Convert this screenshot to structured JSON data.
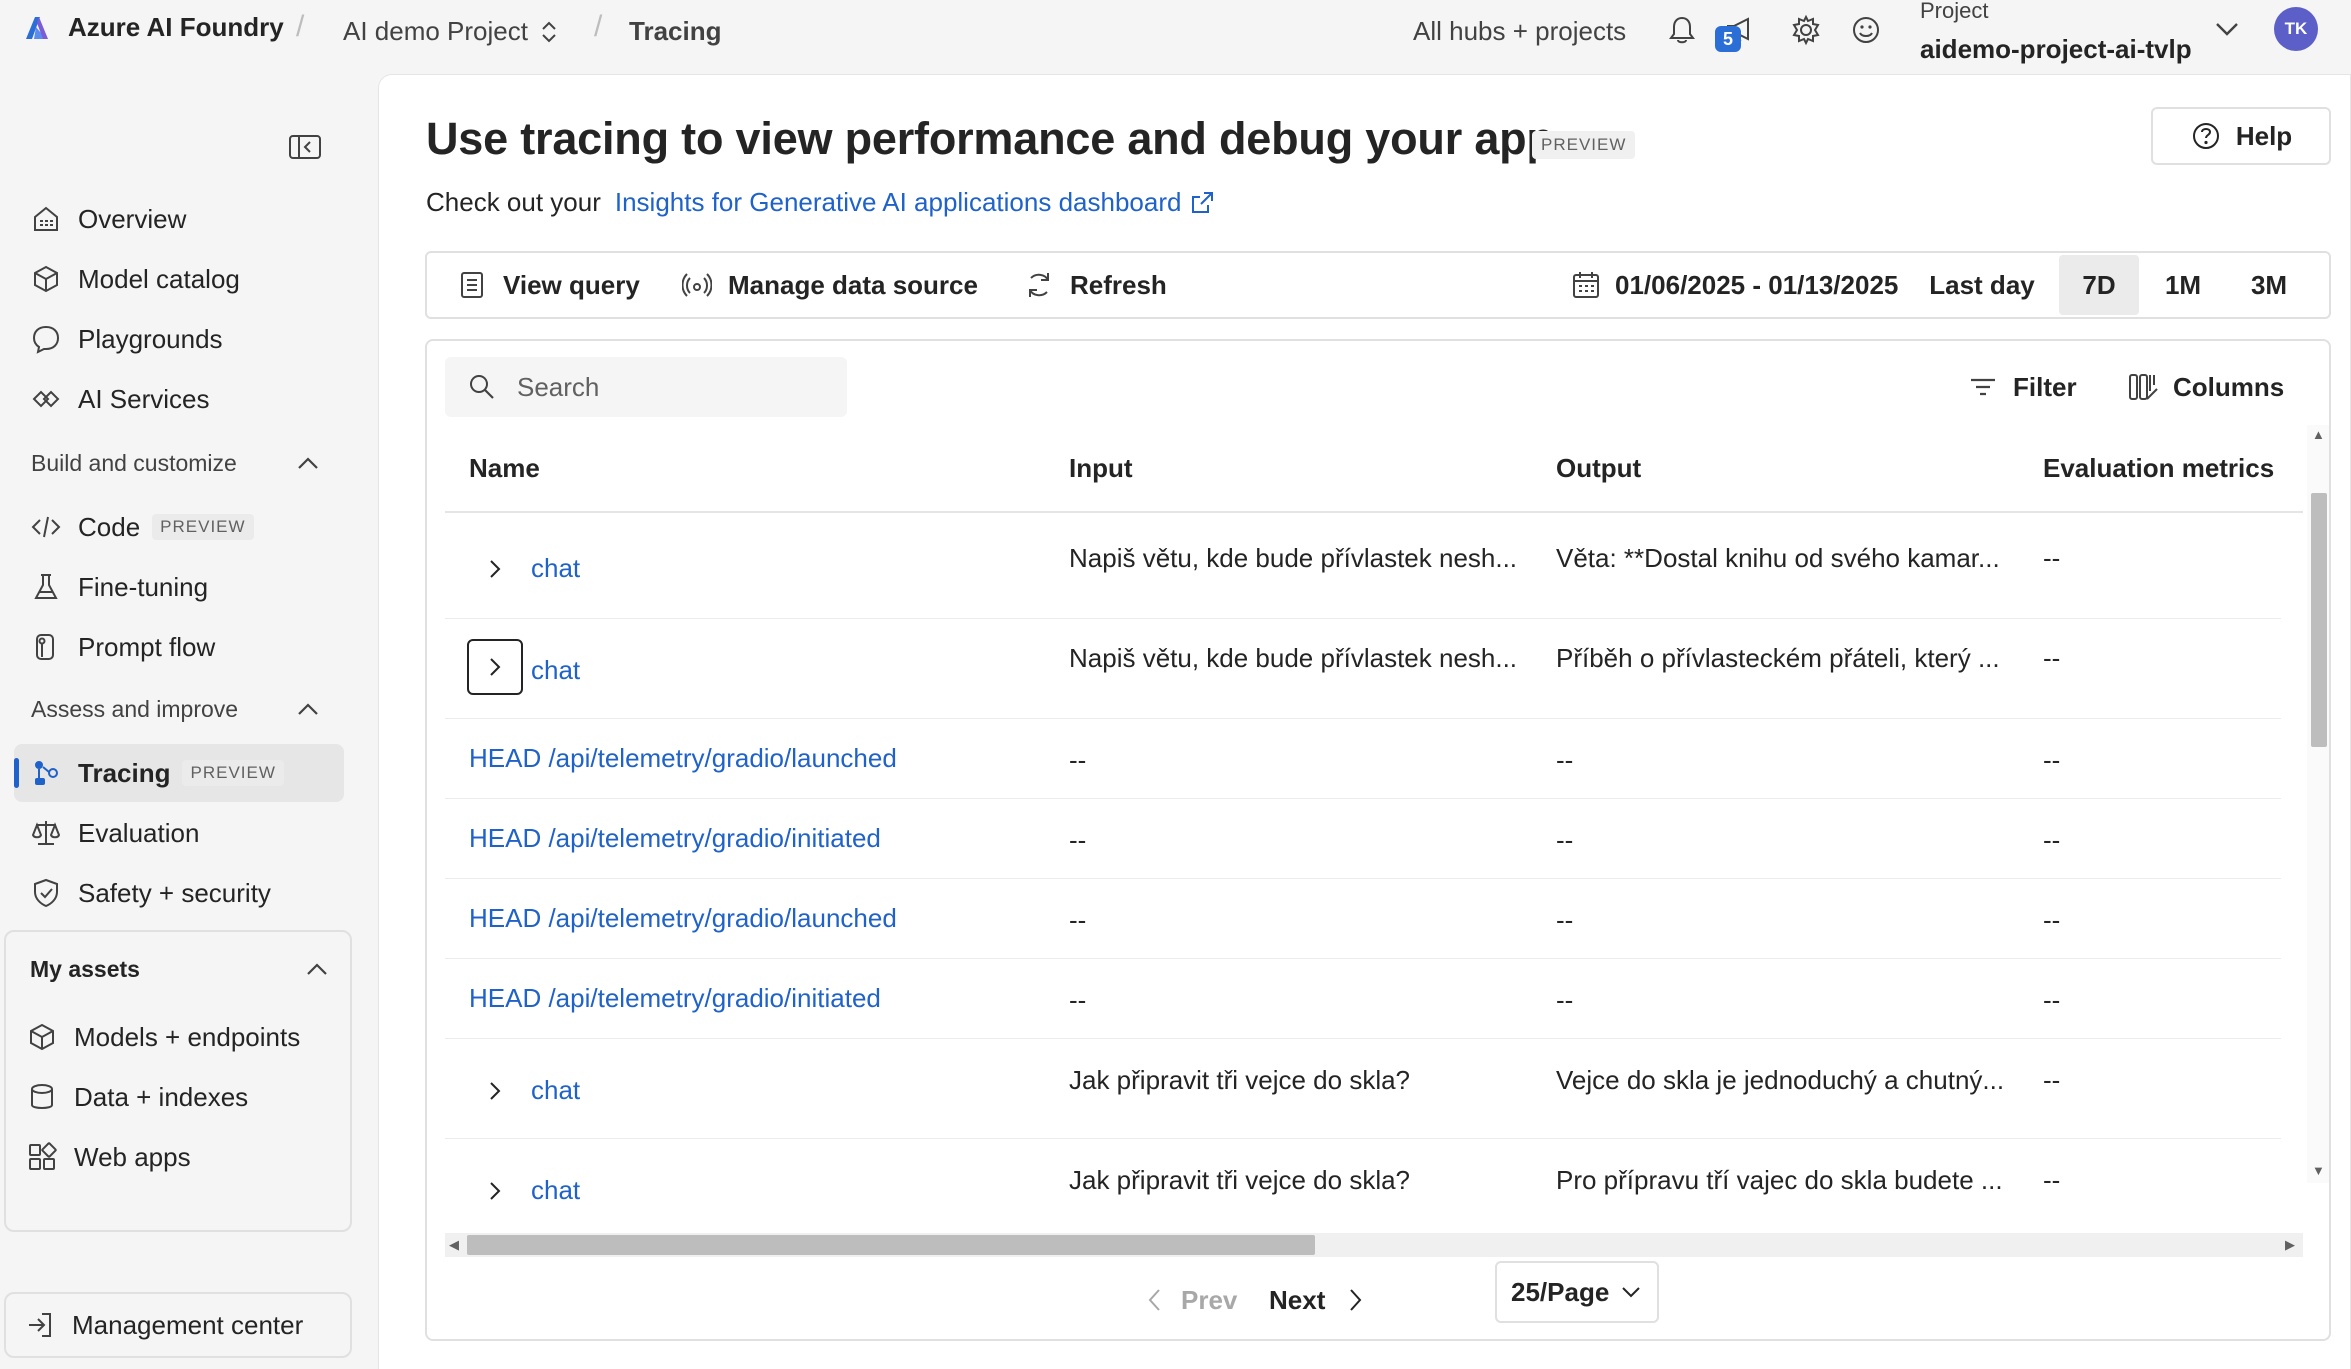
{
  "topbar": {
    "brand": "Azure AI Foundry",
    "project_crumb": "AI demo Project",
    "current_crumb": "Tracing",
    "hubs_link": "All hubs + projects",
    "notification_count": "5",
    "project_label": "Project",
    "project_name": "aidemo-project-ai-tvlp",
    "avatar_initials": "TK"
  },
  "sidebar": {
    "top_items": [
      {
        "label": "Overview",
        "icon": "overview-icon"
      },
      {
        "label": "Model catalog",
        "icon": "cube-icon"
      },
      {
        "label": "Playgrounds",
        "icon": "chat-icon"
      },
      {
        "label": "AI Services",
        "icon": "services-icon"
      }
    ],
    "build_section": "Build and customize",
    "build_items": [
      {
        "label": "Code",
        "tag": "PREVIEW",
        "icon": "code-icon"
      },
      {
        "label": "Fine-tuning",
        "icon": "flask-icon"
      },
      {
        "label": "Prompt flow",
        "icon": "flow-icon"
      }
    ],
    "assess_section": "Assess and improve",
    "assess_items": [
      {
        "label": "Tracing",
        "tag": "PREVIEW",
        "icon": "tracing-icon",
        "active": true
      },
      {
        "label": "Evaluation",
        "icon": "scale-icon"
      },
      {
        "label": "Safety + security",
        "icon": "shield-icon"
      }
    ],
    "assets_section": "My assets",
    "asset_items": [
      {
        "label": "Models + endpoints",
        "icon": "cube-icon"
      },
      {
        "label": "Data + indexes",
        "icon": "database-icon"
      },
      {
        "label": "Web apps",
        "icon": "apps-icon"
      }
    ],
    "management": "Management center"
  },
  "main": {
    "title": "Use tracing to view performance and debug your app",
    "title_tag": "PREVIEW",
    "help": "Help",
    "subline_prefix": "Check out your",
    "subline_link": "Insights for Generative AI applications dashboard"
  },
  "toolbar": {
    "view_query": "View query",
    "manage_source": "Manage data source",
    "refresh": "Refresh",
    "date_range": "01/06/2025 - 01/13/2025",
    "ranges": [
      "Last day",
      "7D",
      "1M",
      "3M"
    ],
    "selected_range": "7D"
  },
  "table": {
    "search_placeholder": "Search",
    "filter": "Filter",
    "columns": "Columns",
    "headers": [
      "Name",
      "Input",
      "Output",
      "Evaluation metrics"
    ],
    "rows": [
      {
        "name": "chat",
        "expandable": true,
        "input": "Napiš větu, kde bude přívlastek nesh...",
        "output": "Věta: **Dostal knihu od svého kamar...",
        "metrics": "--"
      },
      {
        "name": "chat",
        "expandable": true,
        "focused": true,
        "input": "Napiš větu, kde bude přívlastek nesh...",
        "output": "Příběh o přívlasteckém přáteli, který ...",
        "metrics": "--"
      },
      {
        "name": "HEAD /api/telemetry/gradio/launched",
        "expandable": false,
        "input": "--",
        "output": "--",
        "metrics": "--"
      },
      {
        "name": "HEAD /api/telemetry/gradio/initiated",
        "expandable": false,
        "input": "--",
        "output": "--",
        "metrics": "--"
      },
      {
        "name": "HEAD /api/telemetry/gradio/launched",
        "expandable": false,
        "input": "--",
        "output": "--",
        "metrics": "--"
      },
      {
        "name": "HEAD /api/telemetry/gradio/initiated",
        "expandable": false,
        "input": "--",
        "output": "--",
        "metrics": "--"
      },
      {
        "name": "chat",
        "expandable": true,
        "input": "Jak připravit tři vejce do skla?",
        "output": "Vejce do skla je jednoduchý a chutný...",
        "metrics": "--"
      },
      {
        "name": "chat",
        "expandable": true,
        "input": "Jak připravit tři vejce do skla?",
        "output": "Pro přípravu tří vajec do skla budete ...",
        "metrics": "--"
      }
    ]
  },
  "pagination": {
    "prev": "Prev",
    "next": "Next",
    "page_size": "25/Page"
  },
  "colors": {
    "accent": "#1f62c9",
    "avatar": "#5b5fc7",
    "badge": "#2b6fd6"
  }
}
